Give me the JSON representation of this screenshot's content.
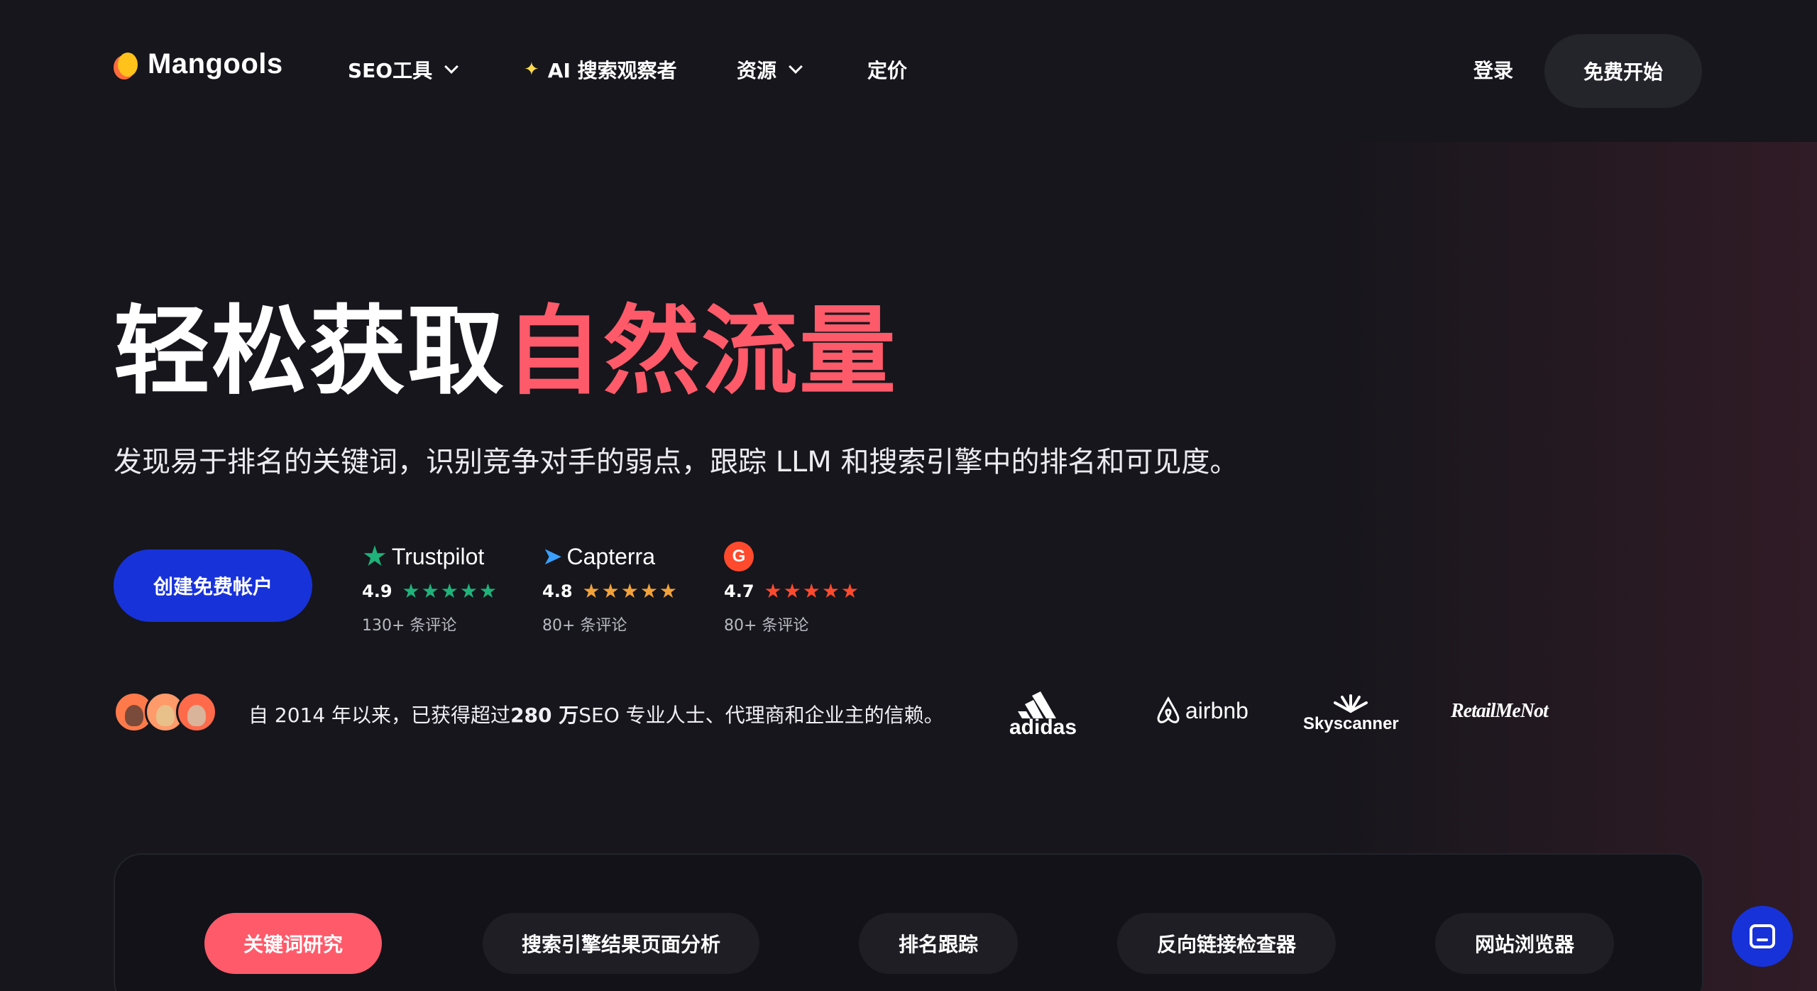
{
  "nav": {
    "logo_text": "Mangools",
    "items": [
      {
        "label": "SEO工具",
        "has_dropdown": true
      },
      {
        "label": "AI 搜索观察者",
        "icon": "sparkle-icon"
      },
      {
        "label": "资源",
        "has_dropdown": true
      },
      {
        "label": "定价"
      }
    ],
    "login_label": "登录",
    "start_label": "免费开始"
  },
  "hero": {
    "title_main": "轻松获取",
    "title_accent": "自然流量",
    "subtitle": "发现易于排名的关键词，识别竞争对手的弱点，跟踪 LLM 和搜索引擎中的排名和可见度。",
    "cta_label": "创建免费帐户",
    "accent_color": "#ff5a6a",
    "cta_color": "#1832d9"
  },
  "ratings": [
    {
      "brand": "Trustpilot",
      "score": "4.9",
      "count": "130+ 条评论",
      "star_color": "#1fb27a",
      "stars": 5
    },
    {
      "brand": "Capterra",
      "score": "4.8",
      "count": "80+ 条评论",
      "star_color": "#f2a23a",
      "stars": 5
    },
    {
      "brand": "G2",
      "score": "4.7",
      "count": "80+ 条评论",
      "star_color": "#ff4a2e",
      "stars": 5
    }
  ],
  "trust": {
    "text_before": "自 2014 年以来，已获得超过",
    "text_bold": "280 万",
    "text_after": "SEO 专业人士、代理商和企业主的信赖。"
  },
  "clients": [
    {
      "name": "adidas",
      "icon": "adidas-logo"
    },
    {
      "name": "airbnb",
      "icon": "airbnb-logo"
    },
    {
      "name": "Skyscanner",
      "icon": "skyscanner-logo"
    },
    {
      "name": "RetailMeNot",
      "icon": "retailmenot-logo"
    }
  ],
  "tabs": [
    {
      "label": "关键词研究",
      "active": true
    },
    {
      "label": "搜索引擎结果页面分析",
      "active": false
    },
    {
      "label": "排名跟踪",
      "active": false
    },
    {
      "label": "反向链接检查器",
      "active": false
    },
    {
      "label": "网站浏览器",
      "active": false
    }
  ]
}
